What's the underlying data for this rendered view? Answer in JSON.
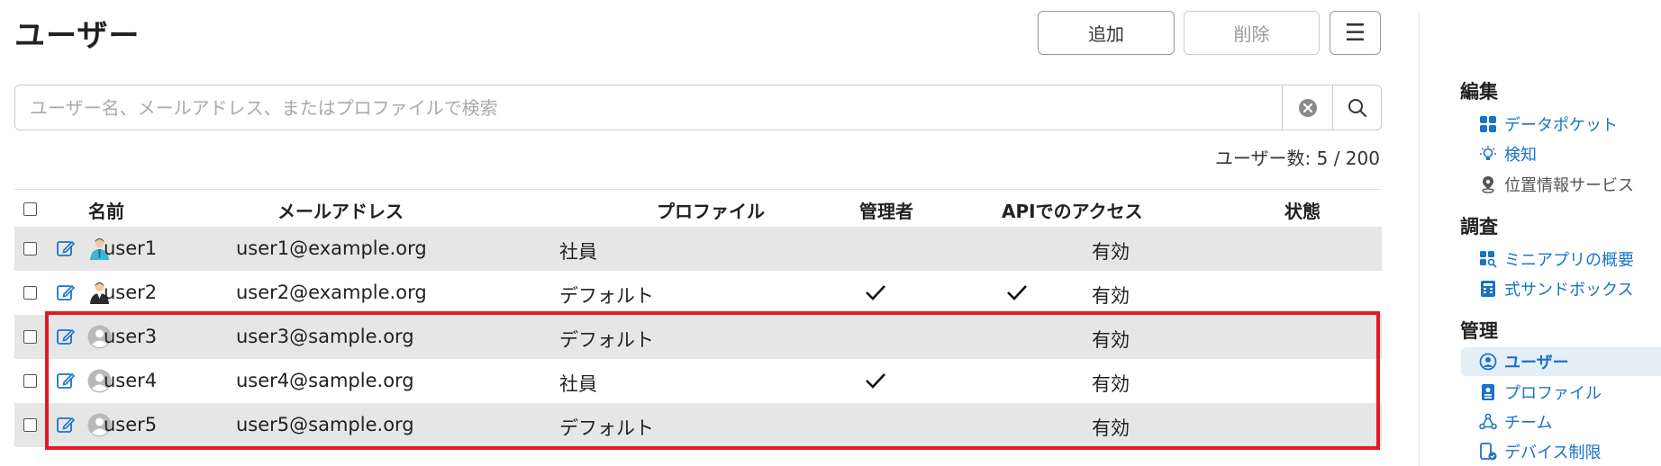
{
  "header": {
    "title": "ユーザー",
    "add_label": "追加",
    "delete_label": "削除",
    "menu_label": "☰"
  },
  "search": {
    "placeholder": "ユーザー名、メールアドレス、またはプロファイルで検索",
    "value": ""
  },
  "user_count": "ユーザー数: 5 / 200",
  "table": {
    "columns": [
      "名前",
      "メールアドレス",
      "プロファイル",
      "管理者",
      "APIでのアクセス",
      "状態"
    ],
    "rows": [
      {
        "name": "user1",
        "email": "user1@example.org",
        "profile": "社員",
        "admin": false,
        "api": false,
        "status": "有効",
        "avatar": "business-person-avatar-icon"
      },
      {
        "name": "user2",
        "email": "user2@example.org",
        "profile": "デフォルト",
        "admin": true,
        "api": true,
        "status": "有効",
        "avatar": "suit-person-avatar-icon"
      },
      {
        "name": "user3",
        "email": "user3@sample.org",
        "profile": "デフォルト",
        "admin": false,
        "api": false,
        "status": "有効",
        "avatar": "default-avatar-icon"
      },
      {
        "name": "user4",
        "email": "user4@sample.org",
        "profile": "社員",
        "admin": true,
        "api": false,
        "status": "有効",
        "avatar": "default-avatar-icon"
      },
      {
        "name": "user5",
        "email": "user5@sample.org",
        "profile": "デフォルト",
        "admin": false,
        "api": false,
        "status": "有効",
        "avatar": "default-avatar-icon"
      }
    ]
  },
  "sidebar": {
    "sections": [
      {
        "heading": "編集",
        "items": [
          {
            "label": "データポケット",
            "icon": "grid-icon"
          },
          {
            "label": "検知",
            "icon": "lightbulb-icon"
          },
          {
            "label": "位置情報サービス",
            "icon": "location-pin-icon"
          }
        ]
      },
      {
        "heading": "調査",
        "items": [
          {
            "label": "ミニアプリの概要",
            "icon": "apps-search-icon"
          },
          {
            "label": "式サンドボックス",
            "icon": "calculator-icon"
          }
        ]
      },
      {
        "heading": "管理",
        "items": [
          {
            "label": "ユーザー",
            "icon": "user-circle-icon",
            "active": true
          },
          {
            "label": "プロファイル",
            "icon": "id-badge-icon"
          },
          {
            "label": "チーム",
            "icon": "team-icon"
          },
          {
            "label": "デバイス制限",
            "icon": "device-restriction-icon"
          }
        ]
      }
    ]
  },
  "colors": {
    "accent": "#1a73c8",
    "highlight": "#e11a22",
    "row_shade": "#e6e6e6"
  }
}
